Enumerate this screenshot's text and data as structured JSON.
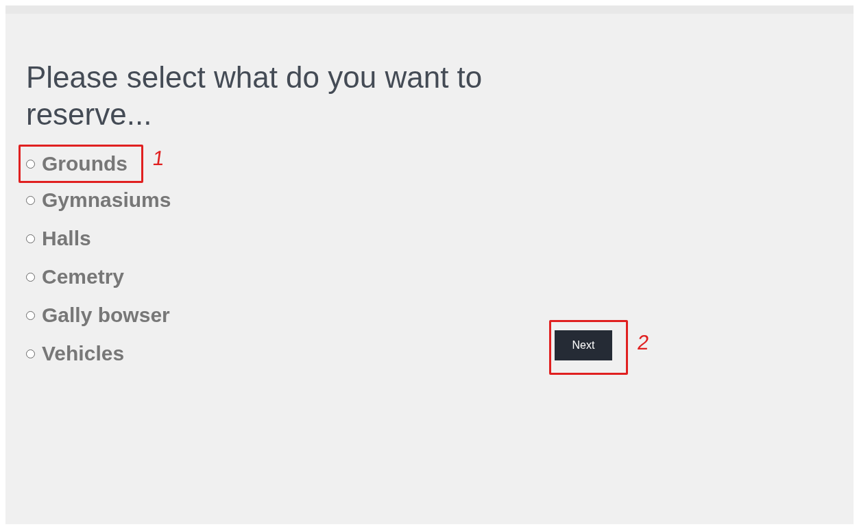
{
  "heading": "Please select what do you want to reserve...",
  "options": [
    {
      "label": "Grounds",
      "selected": false,
      "annotation": "1"
    },
    {
      "label": "Gymnasiums",
      "selected": false
    },
    {
      "label": "Halls",
      "selected": false
    },
    {
      "label": "Cemetry",
      "selected": false
    },
    {
      "label": "Gally bowser",
      "selected": false
    },
    {
      "label": "Vehicles",
      "selected": false
    }
  ],
  "next_button": {
    "label": "Next",
    "annotation": "2"
  }
}
